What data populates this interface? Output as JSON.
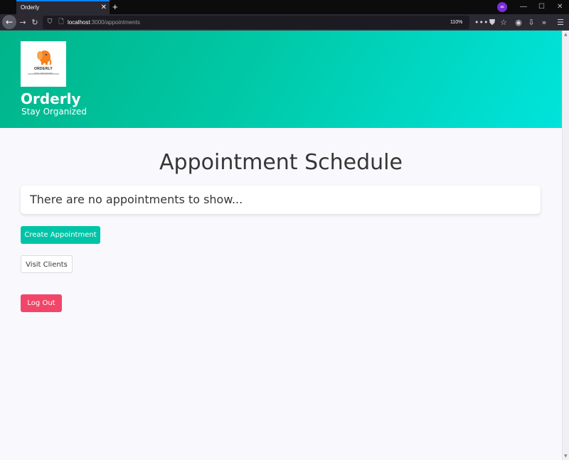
{
  "browser": {
    "tab_title": "Orderly",
    "tab_close": "✕",
    "new_tab": "+",
    "url_host": "localhost",
    "url_path": ":3000/appointments",
    "zoom": "110%"
  },
  "header": {
    "logo_text": "ORDERLY",
    "logo_subtext": "STAY ORGANIZED",
    "brand_title": "Orderly",
    "brand_subtitle": "Stay Organized"
  },
  "main": {
    "title": "Appointment Schedule",
    "empty_message": "There are no appointments to show..."
  },
  "actions": {
    "create_appointment": "Create Appointment",
    "visit_clients": "Visit Clients",
    "log_out": "Log Out"
  },
  "colors": {
    "primary": "#00c4a7",
    "danger": "#f14668",
    "hero_start": "#00b489",
    "hero_end": "#00e4dc"
  }
}
